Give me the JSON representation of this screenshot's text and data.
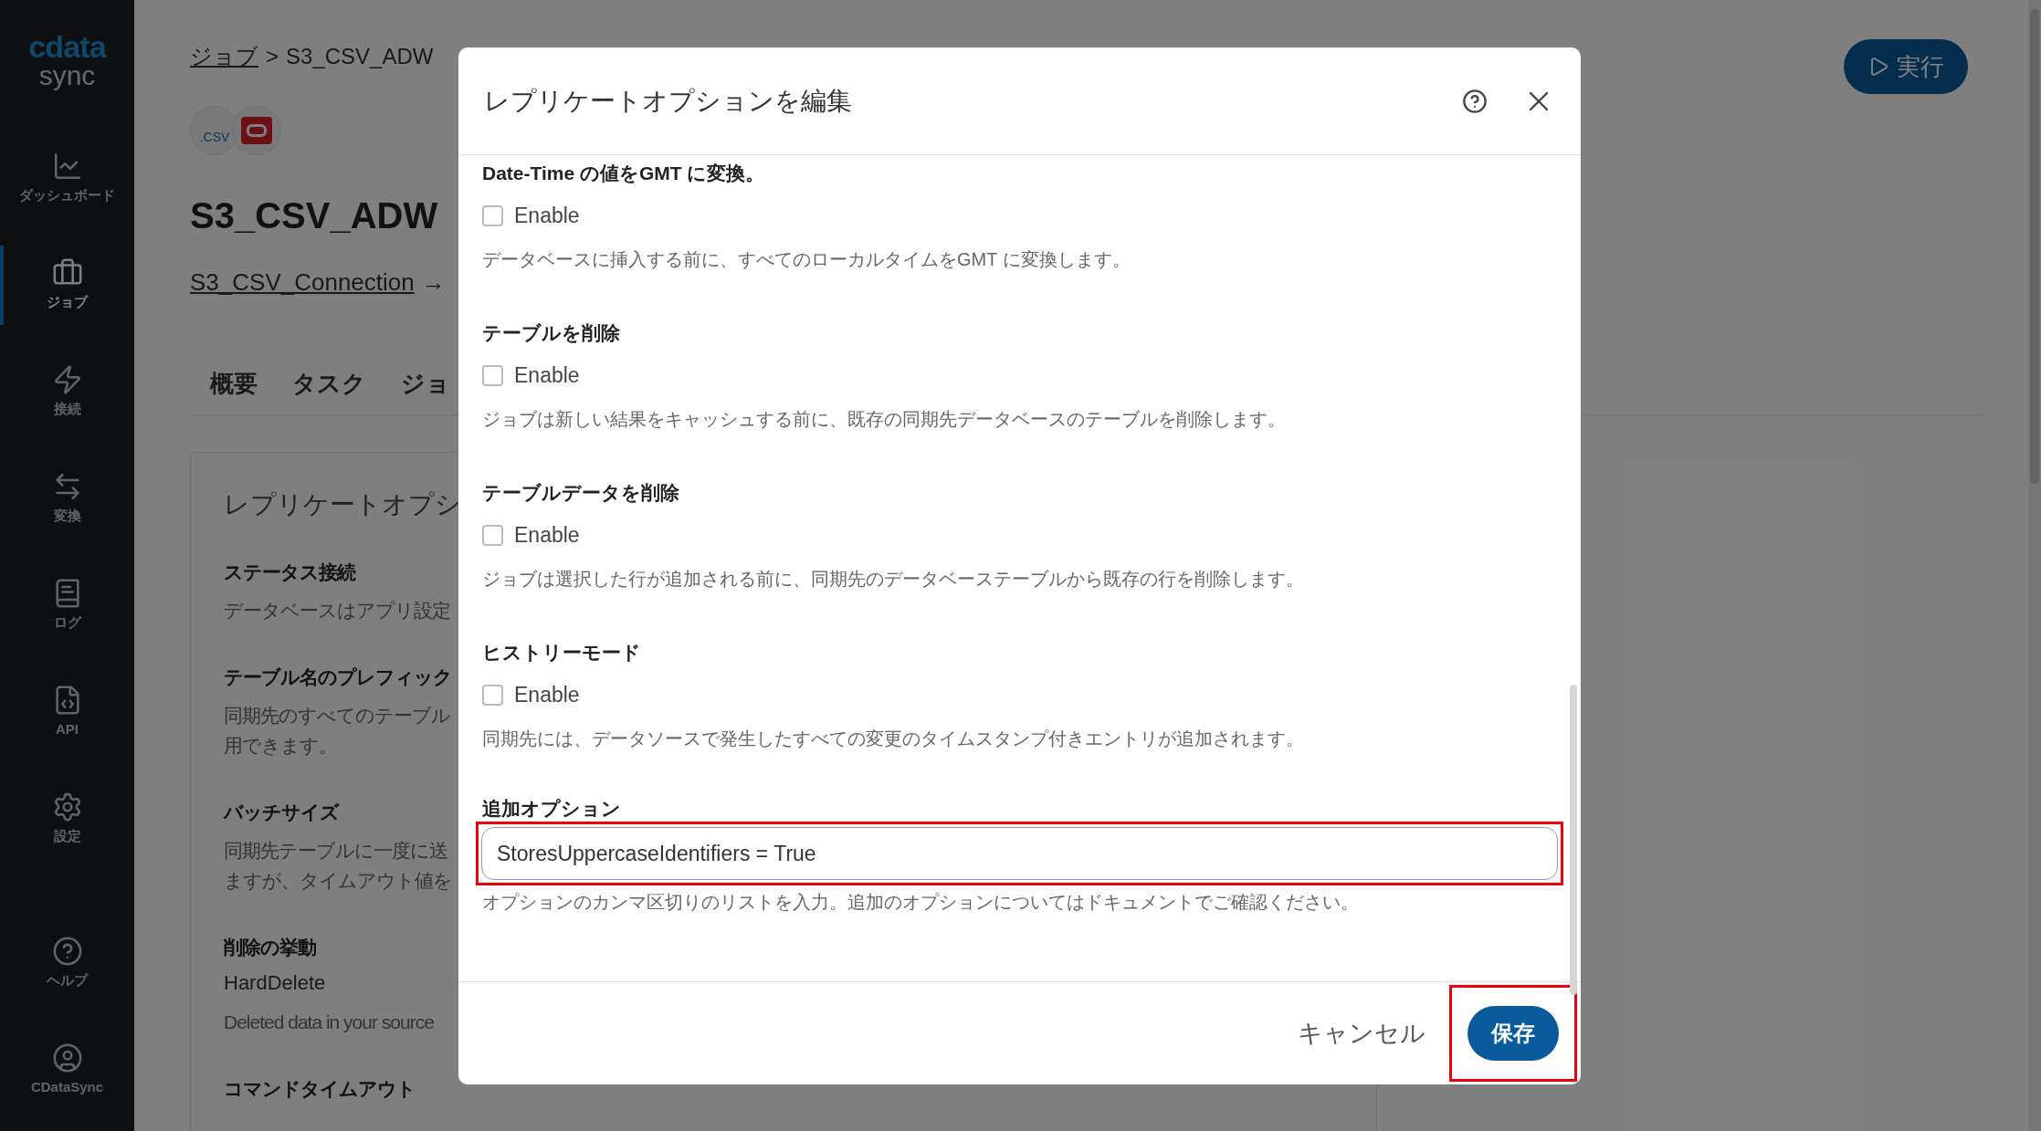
{
  "sidebar": {
    "logo": {
      "brand": "cdata",
      "product": "sync"
    },
    "items": [
      {
        "label": "ダッシュボード",
        "selected": false
      },
      {
        "label": "ジョブ",
        "selected": true
      },
      {
        "label": "接続",
        "selected": false
      },
      {
        "label": "変換",
        "selected": false
      },
      {
        "label": "ログ",
        "selected": false
      },
      {
        "label": "API",
        "selected": false
      },
      {
        "label": "設定",
        "selected": false
      }
    ],
    "bottom_items": [
      {
        "label": "ヘルプ",
        "selected": false
      },
      {
        "label": "CDataSync",
        "selected": false
      }
    ]
  },
  "page": {
    "breadcrumb": {
      "parent": "ジョブ",
      "separator": ">",
      "current": "S3_CSV_ADW"
    },
    "source_badge": ".CSV",
    "title": "S3_CSV_ADW",
    "connection_link": "S3_CSV_Connection",
    "arrow": "→",
    "tabs": [
      "概要",
      "タスク",
      "ジョ"
    ],
    "run_button": "実行",
    "card": {
      "title": "レプリケートオプシ",
      "settings": [
        {
          "label": "ステータス接続",
          "lines": [
            "データベースはアプリ設定"
          ]
        },
        {
          "label": "テーブル名のプレフィック",
          "lines": [
            "同期先のすべてのテーブル",
            "用できます。"
          ]
        },
        {
          "label": "バッチサイズ",
          "lines": [
            "同期先テーブルに一度に送",
            "ますが、タイムアウト値を"
          ]
        },
        {
          "label": "削除の挙動",
          "value": "HardDelete",
          "lines": [
            "Deleted data in your source"
          ]
        },
        {
          "label": "コマンドタイムアウト"
        }
      ]
    }
  },
  "dialog": {
    "title": "レプリケートオプションを編集",
    "options": [
      {
        "label": "Date-Time の値をGMT に変換。",
        "checkbox_label": "Enable",
        "checked": false,
        "description": "データベースに挿入する前に、すべてのローカルタイムをGMT に変換します。"
      },
      {
        "label": "テーブルを削除",
        "checkbox_label": "Enable",
        "checked": false,
        "description": "ジョブは新しい結果をキャッシュする前に、既存の同期先データベースのテーブルを削除します。"
      },
      {
        "label": "テーブルデータを削除",
        "checkbox_label": "Enable",
        "checked": false,
        "description": "ジョブは選択した行が追加される前に、同期先のデータベーステーブルから既存の行を削除します。"
      },
      {
        "label": "ヒストリーモード",
        "checkbox_label": "Enable",
        "checked": false,
        "description": "同期先には、データソースで発生したすべての変更のタイムスタンプ付きエントリが追加されます。"
      }
    ],
    "additional_options": {
      "label": "追加オプション",
      "value": "StoresUppercaseIdentifiers = True",
      "helper": "オプションのカンマ区切りのリストを入力。追加のオプションについてはドキュメントでご確認ください。"
    },
    "cancel_button": "キャンセル",
    "save_button": "保存"
  }
}
